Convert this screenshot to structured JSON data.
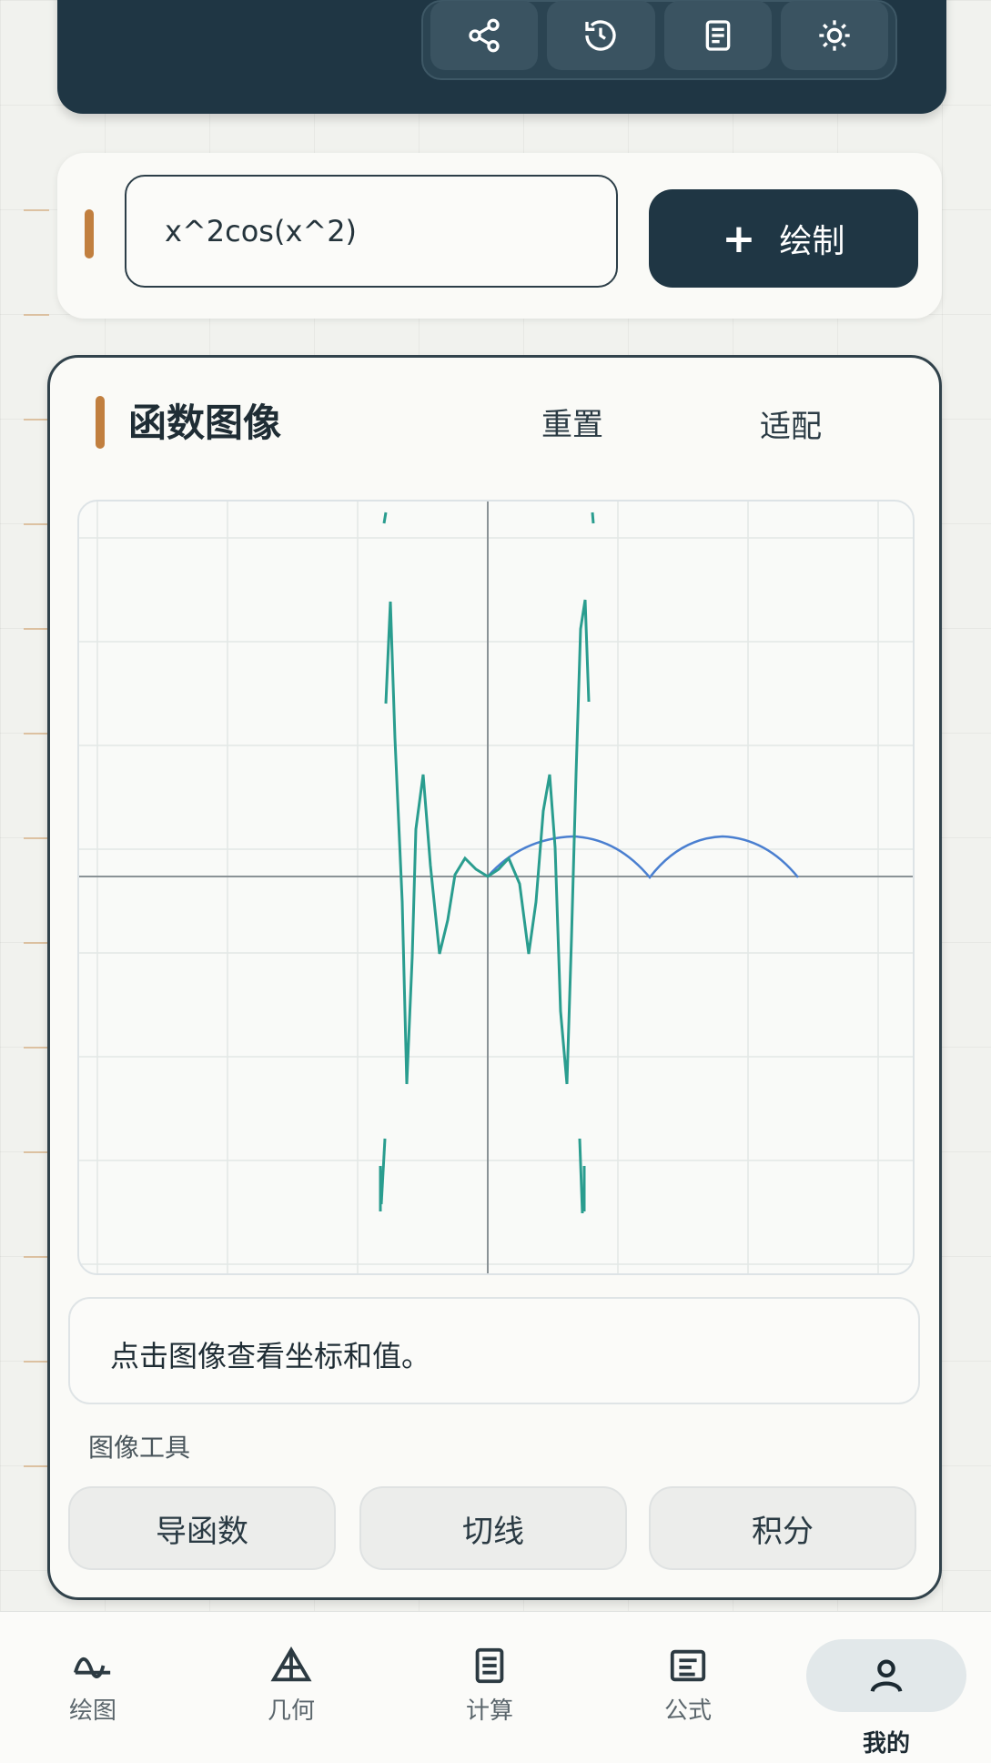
{
  "header": {
    "tools": [
      {
        "icon": "share-icon"
      },
      {
        "icon": "history-icon"
      },
      {
        "icon": "document-icon"
      },
      {
        "icon": "brightness-icon"
      }
    ]
  },
  "input": {
    "expression": "x^2cos(x^2)",
    "plot_button": "绘制",
    "plot_button_icon": "plus-icon"
  },
  "graph": {
    "title": "函数图像",
    "reset": "重置",
    "fit": "适配",
    "info": "点击图像查看坐标和值。",
    "tools_label": "图像工具",
    "tools": [
      "导函数",
      "切线",
      "积分"
    ]
  },
  "nav": [
    {
      "label": "绘图",
      "icon": "graph-icon"
    },
    {
      "label": "几何",
      "icon": "geometry-icon"
    },
    {
      "label": "计算",
      "icon": "calculator-icon"
    },
    {
      "label": "公式",
      "icon": "formula-icon"
    },
    {
      "label": "我的",
      "icon": "user-icon",
      "active": true
    }
  ],
  "colors": {
    "primary": "#1f3644",
    "accent": "#c17f3f",
    "curve_main": "#2a9d8f",
    "curve_secondary": "#4a7fd0"
  }
}
